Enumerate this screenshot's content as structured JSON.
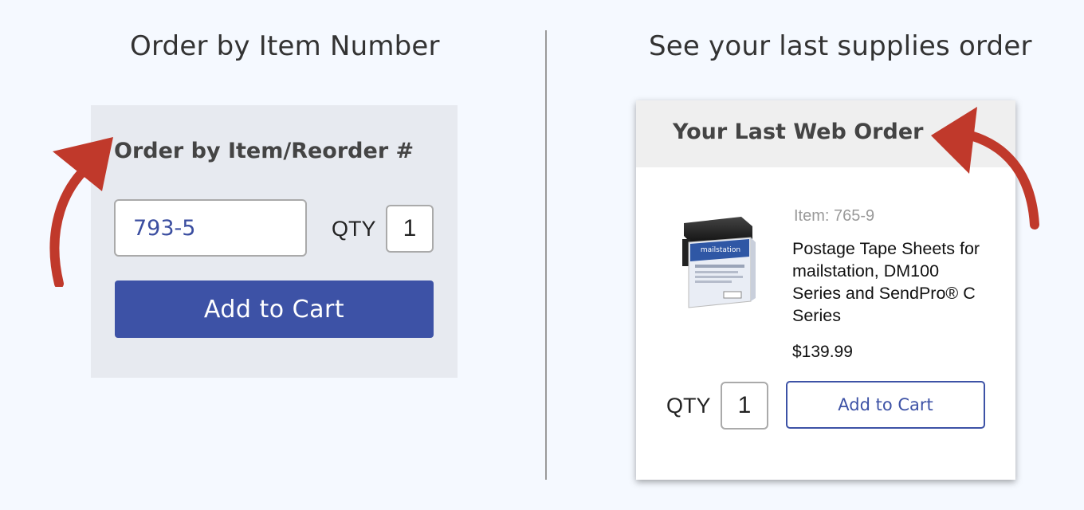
{
  "left": {
    "heading": "Order by Item Number",
    "panel_title": "Order by Item/Reorder #",
    "item_input_value": "793-5",
    "qty_label": "QTY",
    "qty_value": "1",
    "add_to_cart_label": "Add to Cart"
  },
  "right": {
    "heading": "See your last supplies order",
    "card_title": "Your Last Web Order",
    "item_number": "Item: 765-9",
    "product_name": "Postage Tape Sheets for mailstation, DM100 Series and SendPro® C Series",
    "price": "$139.99",
    "qty_label": "QTY",
    "qty_value": "1",
    "add_to_cart_label": "Add to Cart"
  },
  "colors": {
    "accent": "#3d52a6",
    "arrow": "#c0392b",
    "page_background": "#f5f9ff",
    "panel_background": "#e7eaf0"
  },
  "icons": {
    "left_arrow": "curved-arrow-icon",
    "right_arrow": "curved-arrow-icon",
    "product": "ink-cartridge-icon"
  }
}
